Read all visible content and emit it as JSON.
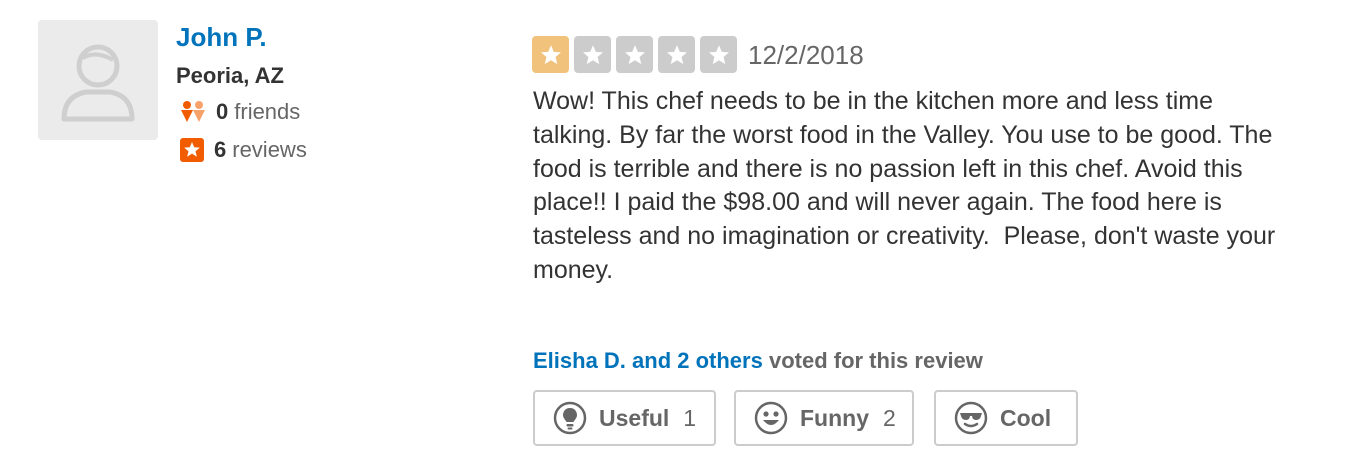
{
  "user": {
    "name": "John P.",
    "location": "Peoria, AZ",
    "friends_count": "0",
    "friends_label": "friends",
    "reviews_count": "6",
    "reviews_label": "reviews"
  },
  "review": {
    "rating": 1,
    "rating_max": 5,
    "date": "12/2/2018",
    "text": "Wow! This chef needs to be in the kitchen more and less time talking. By far the worst food in the Valley. You use to be good. The food is terrible and there is no passion left in this chef. Avoid this place!! I paid the $98.00 and will never again. The food here is tasteless and no imagination or creativity.  Please, don't waste your money."
  },
  "votes": {
    "voters": "Elisha D. and 2 others",
    "suffix": " voted for this review",
    "buttons": {
      "useful": {
        "label": "Useful",
        "count": "1",
        "icon": "lightbulb-icon"
      },
      "funny": {
        "label": "Funny",
        "count": "2",
        "icon": "smiley-icon"
      },
      "cool": {
        "label": "Cool",
        "count": "",
        "icon": "sunglasses-icon"
      }
    }
  },
  "colors": {
    "link": "#0073bb",
    "star_active": "#f0c27b",
    "star_inactive": "#cccccc",
    "friends_icon": "#f15c00",
    "reviews_icon": "#f15c00"
  }
}
